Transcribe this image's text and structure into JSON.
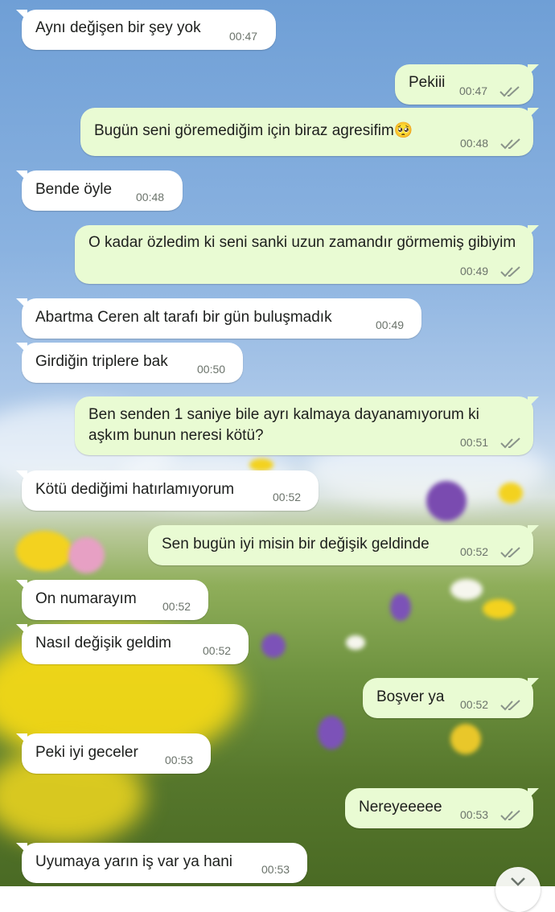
{
  "messages": [
    {
      "dir": "in",
      "text": "Aynı değişen bir şey yok",
      "time": "00:47"
    },
    {
      "dir": "out",
      "text": "Pekiii",
      "time": "00:47"
    },
    {
      "dir": "out",
      "text": "Bugün seni göremediğim için biraz agresifim🥺",
      "time": "00:48"
    },
    {
      "dir": "in",
      "text": "Bende öyle",
      "time": "00:48"
    },
    {
      "dir": "out",
      "text": "O kadar özledim ki seni sanki uzun zamandır görmemiş gibiyim",
      "time": "00:49"
    },
    {
      "dir": "in",
      "text": "Abartma Ceren alt tarafı bir gün buluşmadık",
      "time": "00:49"
    },
    {
      "dir": "in",
      "text": "Girdiğin triplere bak",
      "time": "00:50"
    },
    {
      "dir": "out",
      "text": "Ben senden 1 saniye bile ayrı kalmaya dayanamıyorum ki aşkım bunun neresi kötü?",
      "time": "00:51"
    },
    {
      "dir": "in",
      "text": "Kötü dediğimi hatırlamıyorum",
      "time": "00:52"
    },
    {
      "dir": "out",
      "text": "Sen bugün iyi misin bir değişik geldinde",
      "time": "00:52"
    },
    {
      "dir": "in",
      "text": "On numarayım",
      "time": "00:52"
    },
    {
      "dir": "in",
      "text": "Nasıl değişik geldim",
      "time": "00:52"
    },
    {
      "dir": "out",
      "text": "Boşver ya",
      "time": "00:52"
    },
    {
      "dir": "in",
      "text": "Peki iyi geceler",
      "time": "00:53"
    },
    {
      "dir": "out",
      "text": "Nereyeeeee",
      "time": "00:53"
    },
    {
      "dir": "in",
      "text": "Uyumaya yarın iş var ya hani",
      "time": "00:53"
    }
  ],
  "colors": {
    "incoming_bubble": "#ffffff",
    "outgoing_bubble": "#e9fbd3",
    "read_ticks": "#8a948a"
  },
  "icons": {
    "read_receipt": "double-check-icon",
    "scroll_down": "chevron-down-icon"
  }
}
